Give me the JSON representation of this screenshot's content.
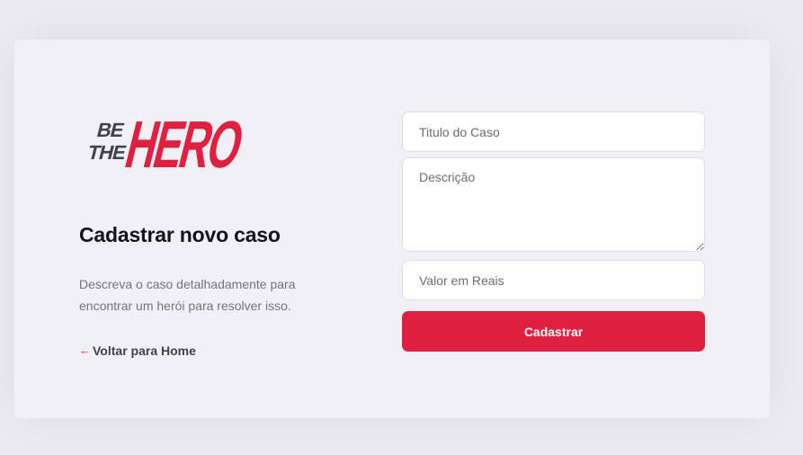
{
  "logo": {
    "line1": "BE",
    "line2": "THE",
    "word": "HERO",
    "colors": {
      "small_text": "#41414d",
      "accent": "#e02041"
    }
  },
  "page": {
    "title": "Cadastrar novo caso",
    "description": "Descreva o caso detalhadamente para encontrar um herói para resolver isso.",
    "back_link": {
      "icon": "arrow-left-icon",
      "icon_glyph": "←",
      "label": "Voltar para Home"
    }
  },
  "form": {
    "title_field": {
      "placeholder": "Titulo do Caso",
      "value": ""
    },
    "description_field": {
      "placeholder": "Descrição",
      "value": ""
    },
    "value_field": {
      "placeholder": "Valor em Reais",
      "value": ""
    },
    "submit_label": "Cadastrar"
  },
  "colors": {
    "background": "#ebebf0",
    "card": "#f0f0f5",
    "accent": "#e02041",
    "heading": "#13131a",
    "muted_text": "#737380"
  }
}
